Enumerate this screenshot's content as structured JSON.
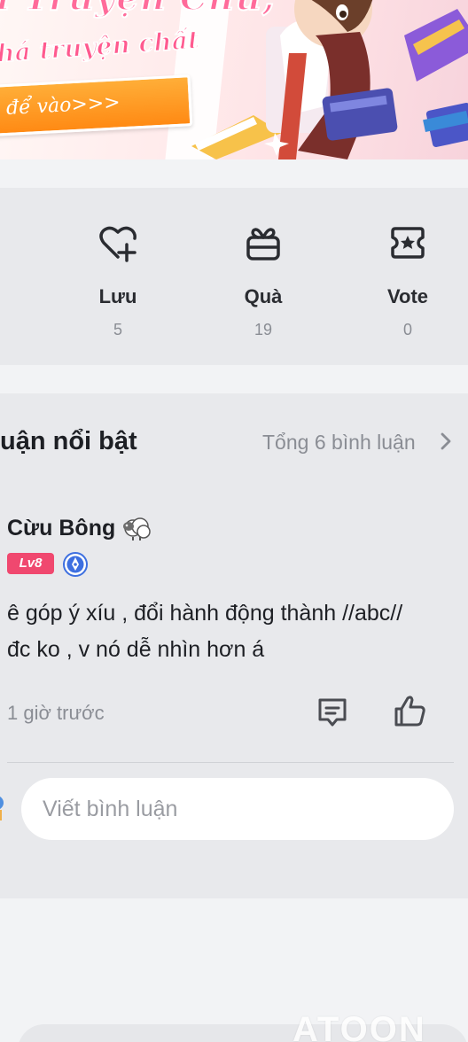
{
  "banner": {
    "title": "u Truyện Chữ,",
    "subtitle": "há truyện chất",
    "button_label": "để vào>>>"
  },
  "actions": [
    {
      "label": "Lưu",
      "count": "5",
      "icon": "heart-plus-icon"
    },
    {
      "label": "Quà",
      "count": "19",
      "icon": "gift-icon"
    },
    {
      "label": "Vote",
      "count": "0",
      "icon": "vote-ticket-icon"
    }
  ],
  "comments": {
    "title": "uận nổi bật",
    "total": "Tổng 6 bình luận",
    "item": {
      "user": "Cừu Bông",
      "level": "Lv8",
      "text_line1": "ê góp ý xíu , đổi hành động thành //abc//",
      "text_line2": "đc ko , v nó dễ nhìn hơn á",
      "time": "1 giờ trước"
    },
    "input_placeholder": "Viết bình luận"
  },
  "watermark": "ATOON",
  "colors": {
    "page_bg": "#f2f3f5",
    "panel_bg": "#e8e9ec",
    "level_badge": "#f0486f",
    "muted_text": "#8a8d94",
    "banner_pink": "#ff6b9a",
    "banner_orange": "#ff8a14"
  }
}
